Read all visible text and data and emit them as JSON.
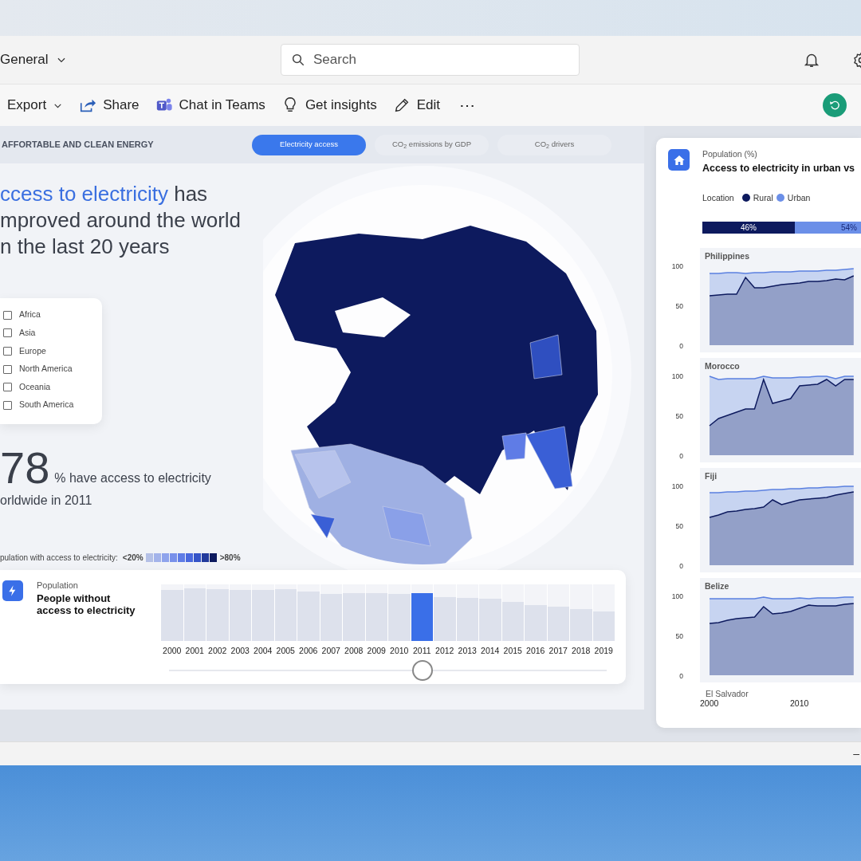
{
  "header": {
    "workspace": "General",
    "search": {
      "placeholder": "Search"
    }
  },
  "toolbar": [
    {
      "label": "Export",
      "kind": "dropdown"
    },
    {
      "label": "Share",
      "kind": "share"
    },
    {
      "label": "Chat in Teams",
      "kind": "teams"
    },
    {
      "label": "Get insights",
      "kind": "insights"
    },
    {
      "label": "Edit",
      "kind": "edit"
    },
    {
      "label": "⋯",
      "kind": "more"
    }
  ],
  "report": {
    "section_title": "AFFORTABLE AND CLEAN ENERGY",
    "tabs": [
      {
        "label": "Electricity access",
        "selected": true
      },
      {
        "label": "CO$_{2}$ emissions by GDP",
        "selected": false
      },
      {
        "label": "CO$_{2}$ drivers",
        "selected": false
      }
    ],
    "headline": {
      "highlight": "ccess to electricity",
      "first_line_rest": "has",
      "lines": [
        "mproved around the world",
        "n the last 20 years"
      ]
    },
    "regions": [
      {
        "label": "Africa",
        "checked": false
      },
      {
        "label": "Asia",
        "checked": false
      },
      {
        "label": "Europe",
        "checked": false
      },
      {
        "label": "North America",
        "checked": false
      },
      {
        "label": "Oceania",
        "checked": false
      },
      {
        "label": "South America",
        "checked": false
      }
    ],
    "stat": {
      "value": "78",
      "caption": "% have access to electricity",
      "caption_line_2": "orldwide in 2011"
    },
    "legend": {
      "label": "pulation with access to electricity:",
      "low": "<20%",
      "high": ">80%"
    },
    "timeline": {
      "subtitle": "Population",
      "title": "People without access to electricity",
      "years": [
        {
          "label": "2000",
          "selected": false
        },
        {
          "label": "2001",
          "selected": false
        },
        {
          "label": "2002",
          "selected": false
        },
        {
          "label": "2003",
          "selected": false
        },
        {
          "label": "2004",
          "selected": false
        },
        {
          "label": "2005",
          "selected": false
        },
        {
          "label": "2006",
          "selected": false
        },
        {
          "label": "2007",
          "selected": false
        },
        {
          "label": "2008",
          "selected": false
        },
        {
          "label": "2009",
          "selected": false
        },
        {
          "label": "2010",
          "selected": false
        },
        {
          "label": "2011",
          "selected": true
        },
        {
          "label": "2012",
          "selected": false
        },
        {
          "label": "2013",
          "selected": false
        },
        {
          "label": "2014",
          "selected": false
        },
        {
          "label": "2015",
          "selected": false
        },
        {
          "label": "2016",
          "selected": false
        },
        {
          "label": "2017",
          "selected": false
        },
        {
          "label": "2018",
          "selected": false
        },
        {
          "label": "2019",
          "selected": false
        }
      ],
      "slider": {
        "level": 0.579
      }
    }
  },
  "side_panel": {
    "subtitle": "Population (%)",
    "title": "Access to electricity in urban vs",
    "legend": {
      "label": "Location",
      "items": [
        {
          "label": "Rural",
          "color": "#0d1a5e"
        },
        {
          "label": "Urban",
          "color": "#6b8fe8"
        }
      ]
    },
    "split": [
      {
        "label": "46%",
        "level": 0.46
      },
      {
        "label": "54%"
      }
    ],
    "charts": [
      {
        "title": "Philippines",
        "y_tick_labels": [
          "100",
          "50",
          "0"
        ]
      },
      {
        "title": "Morocco",
        "y_tick_labels": [
          "100",
          "50",
          "0"
        ]
      },
      {
        "title": "Fiji",
        "y_tick_labels": [
          "100",
          "50",
          "0"
        ]
      },
      {
        "title": "Belize",
        "y_tick_labels": [
          "100",
          "50",
          "0"
        ]
      }
    ],
    "partial_title": "El Salvador",
    "x_axis_labels": [
      "2000",
      "2010"
    ]
  },
  "status_bar": {
    "text": "–"
  }
}
